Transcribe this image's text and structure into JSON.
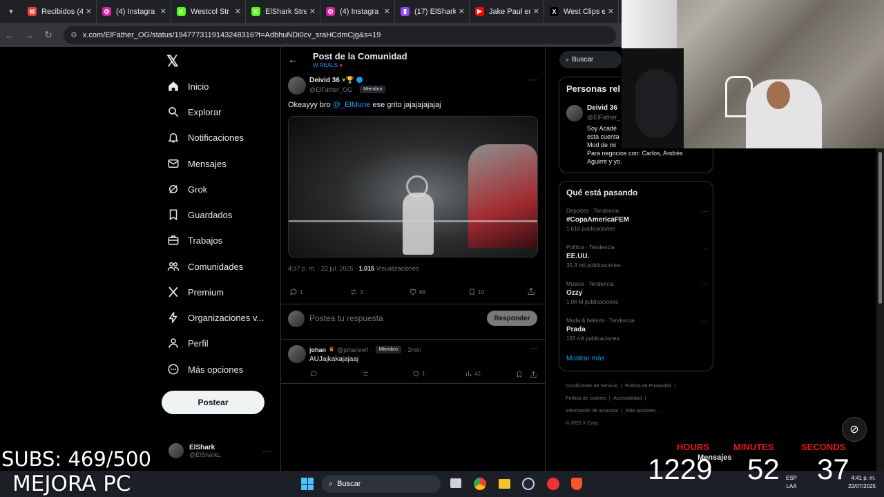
{
  "tabs": [
    {
      "label": "Recibidos (4",
      "color": "#ea4335",
      "glyph": "M"
    },
    {
      "label": "(4) Instagra",
      "color": "#d6249f",
      "glyph": "◎"
    },
    {
      "label": "Westcol Str",
      "color": "#53fc18",
      "glyph": "K"
    },
    {
      "label": "ElShark Stre",
      "color": "#53fc18",
      "glyph": "K"
    },
    {
      "label": "(4) Instagra",
      "color": "#d6249f",
      "glyph": "◎"
    },
    {
      "label": "(17) ElShark",
      "color": "#9146ff",
      "glyph": "▮"
    },
    {
      "label": "Jake Paul er",
      "color": "#ff0000",
      "glyph": "▶"
    },
    {
      "label": "West Clips e",
      "color": "#000000",
      "glyph": "X"
    }
  ],
  "browser": {
    "url": "x.com/ElFather_OG/status/1947773119143248316?t=AdbhuNDi0cv_sraHCdmCjg&s=19"
  },
  "nav": [
    {
      "label": "Inicio",
      "icon": "home-icon"
    },
    {
      "label": "Explorar",
      "icon": "search-icon"
    },
    {
      "label": "Notificaciones",
      "icon": "bell-icon"
    },
    {
      "label": "Mensajes",
      "icon": "envelope-icon"
    },
    {
      "label": "Grok",
      "icon": "grok-icon"
    },
    {
      "label": "Guardados",
      "icon": "bookmark-icon"
    },
    {
      "label": "Trabajos",
      "icon": "briefcase-icon"
    },
    {
      "label": "Comunidades",
      "icon": "people-icon"
    },
    {
      "label": "Premium",
      "icon": "x-icon"
    },
    {
      "label": "Organizaciones v...",
      "icon": "lightning-icon"
    },
    {
      "label": "Perfil",
      "icon": "person-icon"
    },
    {
      "label": "Más opciones",
      "icon": "more-circle-icon"
    }
  ],
  "post_button": "Postear",
  "account": {
    "name": "ElShark",
    "handle": "@ElSharkL"
  },
  "header": {
    "title": "Post de la Comunidad",
    "subtitle": "W REALS"
  },
  "post": {
    "author": "Deivid 36",
    "handle": "@ElFather_OG",
    "member_badge": "Miembro",
    "text_pre": "Okeayyy bro",
    "mention": "@_ElMune",
    "text_post": "ese grito jajajajajajaj",
    "time": "4:37 p. m. · 22 jul. 2025 ·",
    "views": "1.015",
    "views_label": "Visualizaciones",
    "replies": "1",
    "reposts": "5",
    "likes": "66",
    "bookmarks": "10"
  },
  "reply_box": {
    "placeholder": "Postea tu respuesta",
    "button": "Responder"
  },
  "comment": {
    "author": "johan",
    "handle": "@johanxwf",
    "badge": "Miembro",
    "time": "· 2min",
    "text": "AUJajkakajajaaj",
    "likes": "1",
    "views": "42"
  },
  "search": {
    "placeholder": "Buscar"
  },
  "relevant": {
    "title": "Personas rel",
    "name": "Deivid 36",
    "handle": "@ElFather_",
    "bio1": "Soy Acadé",
    "bio2": "esta cuenta",
    "bio3": "Mod de mi",
    "bio4": "Para negocios con: Carlos, Andrés",
    "bio5": "Aguirre y yo."
  },
  "trends": {
    "title": "Qué está pasando",
    "items": [
      {
        "category": "Deportes · Tendencia",
        "title": "#CopaAmericaFEM",
        "count": "1.616 publicaciones"
      },
      {
        "category": "Política · Tendencia",
        "title": "EE.UU.",
        "count": "35,3 mil publicaciones"
      },
      {
        "category": "Música · Tendencia",
        "title": "Ozzy",
        "count": "1,06 M publicaciones"
      },
      {
        "category": "Moda & belleza · Tendencia",
        "title": "Prada",
        "count": "163 mil publicaciones"
      }
    ],
    "show_more": "Mostrar más"
  },
  "footer": {
    "l1": "Condiciones de Servicio",
    "l2": "Política de Privacidad",
    "l3": "Política de cookies",
    "l4": "Accesibilidad",
    "l5": "Información de anuncios",
    "l6": "Más opciones ...",
    "l7": "© 2025 X Corp."
  },
  "overlay": {
    "subs": "SUBS: 469/500",
    "mejora": "MEJORA PC",
    "hours_label": "HOURS",
    "minutes_label": "MINUTES",
    "seconds_label": "SECONDS",
    "hours": "1229",
    "minutes": "52",
    "seconds": "37",
    "messages": "Mensajes"
  },
  "taskbar": {
    "search": "Buscar",
    "lang1": "ESP",
    "lang2": "LAA",
    "time": "4:41 p. m.",
    "date": "22/07/2025"
  }
}
